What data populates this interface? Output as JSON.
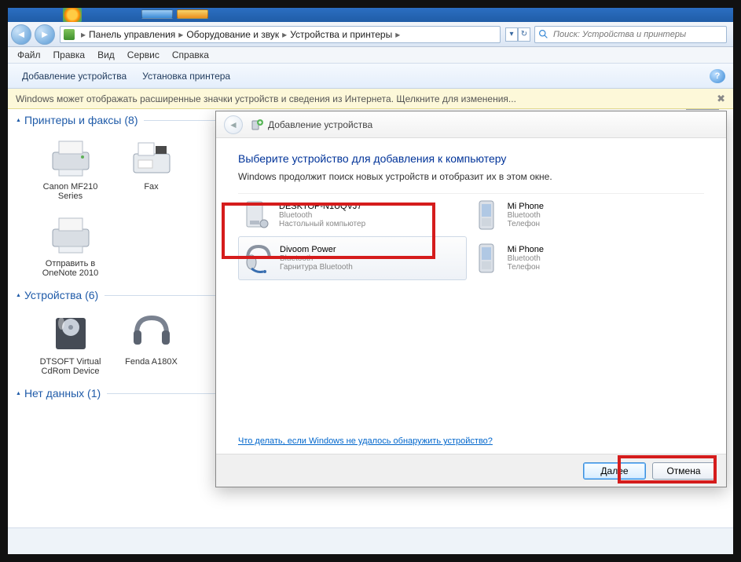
{
  "breadcrumbs": [
    "Панель управления",
    "Оборудование и звук",
    "Устройства и принтеры"
  ],
  "search_placeholder": "Поиск: Устройства и принтеры",
  "menu": [
    "Файл",
    "Правка",
    "Вид",
    "Сервис",
    "Справка"
  ],
  "commands": [
    "Добавление устройства",
    "Установка принтера"
  ],
  "banner": "Windows может отображать расширенные значки устройств и сведения из Интернета.   Щелкните для изменения...",
  "groups": [
    {
      "title": "Принтеры и факсы (8)",
      "items": [
        "Canon MF210 Series",
        "Fax",
        "Отправить в OneNote 2010"
      ]
    },
    {
      "title": "Устройства (6)",
      "items": [
        "DTSOFT Virtual CdRom Device",
        "Fenda A180X"
      ]
    },
    {
      "title": "Нет данных (1)",
      "items": []
    }
  ],
  "dialog": {
    "title": "Добавление устройства",
    "heading": "Выберите устройство для добавления к компьютеру",
    "subtext": "Windows продолжит поиск новых устройств и отобразит их в этом окне.",
    "devices": [
      {
        "name": "DESKTOP-N1UQVJ7",
        "type": "Bluetooth",
        "cat": "Настольный компьютер",
        "icon": "desktop"
      },
      {
        "name": "Mi Phone",
        "type": "Bluetooth",
        "cat": "Телефон",
        "icon": "phone"
      },
      {
        "name": "Divoom Power",
        "type": "Bluetooth",
        "cat": "Гарнитура Bluetooth",
        "icon": "headset",
        "selected": true
      },
      {
        "name": "Mi Phone",
        "type": "Bluetooth",
        "cat": "Телефон",
        "icon": "phone"
      }
    ],
    "help_link": "Что делать, если Windows не удалось обнаружить устройство?",
    "btn_next": "Далее",
    "btn_cancel": "Отмена"
  }
}
